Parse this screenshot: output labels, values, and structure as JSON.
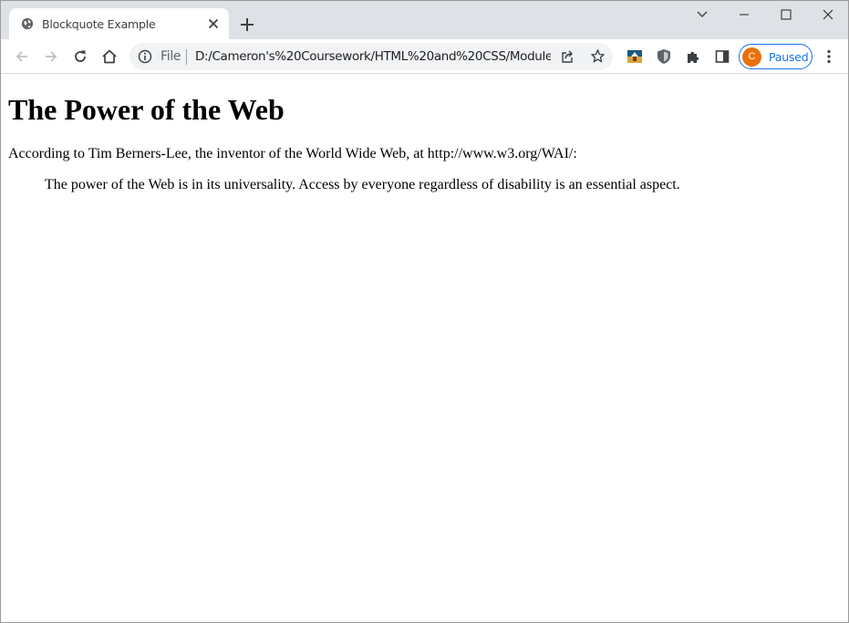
{
  "browser": {
    "tab": {
      "title": "Blockquote Example",
      "favicon": "globe-icon"
    },
    "omnibox": {
      "scheme": "File",
      "url": "D:/Cameron's%20Coursework/HTML%20and%20CSS/Module..."
    },
    "profile": {
      "initial": "C",
      "status": "Paused",
      "avatar_color": "#e8710a",
      "accent": "#1a73e8"
    },
    "colors": {
      "tabstrip": "#dee1e6",
      "toolbar": "#ffffff",
      "omnibox": "#f1f3f4"
    }
  },
  "page": {
    "heading": "The Power of the Web",
    "intro": "According to Tim Berners-Lee, the inventor of the World Wide Web, at http://www.w3.org/WAI/:",
    "quote": "The power of the Web is in its universality. Access by everyone regardless of disability is an essential aspect."
  }
}
